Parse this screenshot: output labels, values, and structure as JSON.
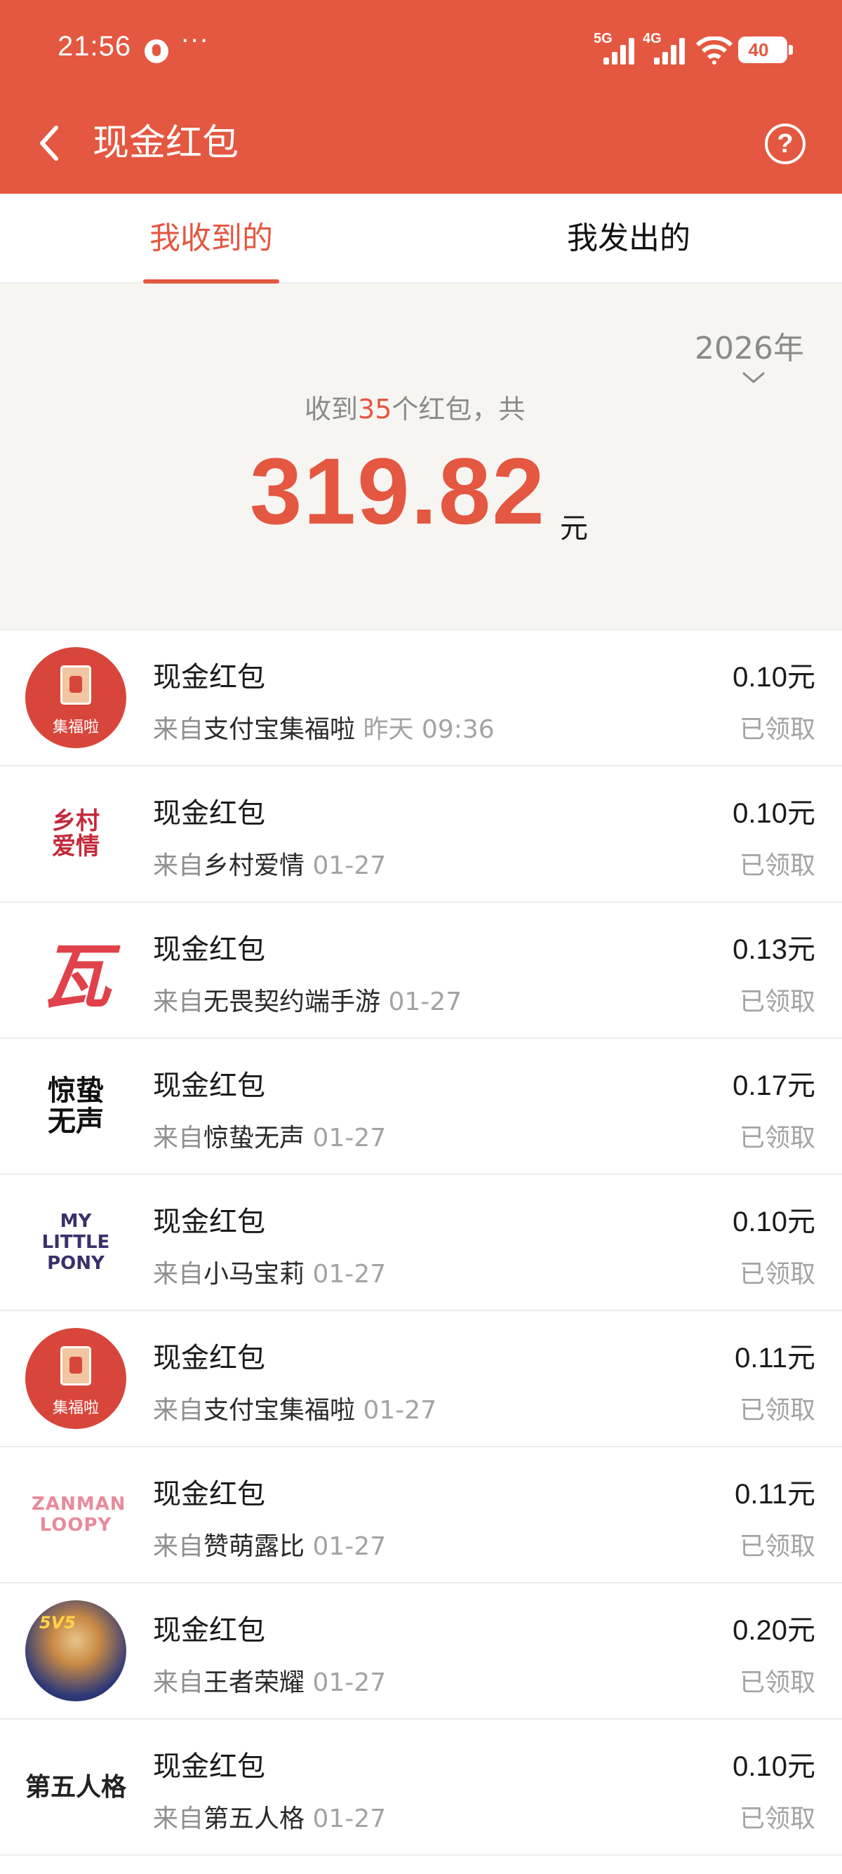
{
  "status_bar": {
    "time": "21:56",
    "more": "···",
    "sim1": "5G",
    "sim2": "4G",
    "battery": "40"
  },
  "header": {
    "title": "现金红包",
    "icons": [
      "back-icon",
      "help-icon"
    ]
  },
  "tabs": [
    {
      "label": "我收到的",
      "active": true
    },
    {
      "label": "我发出的",
      "active": false
    }
  ],
  "summary": {
    "year": "2026年",
    "prefix": "收到",
    "count": "35",
    "suffix": "个红包，共",
    "total": "319.82",
    "unit": "元"
  },
  "list": {
    "items": [
      {
        "title": "现金红包",
        "from_prefix": "来自",
        "source": "支付宝集福啦",
        "date": "昨天 09:36",
        "amount": "0.10",
        "currency": "元",
        "status": "已领取",
        "avatar_text": "集福啦"
      },
      {
        "title": "现金红包",
        "from_prefix": "来自",
        "source": "乡村爱情",
        "date": "01-27",
        "amount": "0.10",
        "currency": "元",
        "status": "已领取",
        "avatar_text": "乡村爱情"
      },
      {
        "title": "现金红包",
        "from_prefix": "来自",
        "source": "无畏契约端手游",
        "date": "01-27",
        "amount": "0.13",
        "currency": "元",
        "status": "已领取",
        "avatar_text": "瓦"
      },
      {
        "title": "现金红包",
        "from_prefix": "来自",
        "source": "惊蛰无声",
        "date": "01-27",
        "amount": "0.17",
        "currency": "元",
        "status": "已领取",
        "avatar_text": "惊蛰无声"
      },
      {
        "title": "现金红包",
        "from_prefix": "来自",
        "source": "小马宝莉",
        "date": "01-27",
        "amount": "0.10",
        "currency": "元",
        "status": "已领取",
        "avatar_text": "MY LITTLE PONY"
      },
      {
        "title": "现金红包",
        "from_prefix": "来自",
        "source": "支付宝集福啦",
        "date": "01-27",
        "amount": "0.11",
        "currency": "元",
        "status": "已领取",
        "avatar_text": "集福啦"
      },
      {
        "title": "现金红包",
        "from_prefix": "来自",
        "source": "赞萌露比",
        "date": "01-27",
        "amount": "0.11",
        "currency": "元",
        "status": "已领取",
        "avatar_text": "ZANMANG LOOPY"
      },
      {
        "title": "现金红包",
        "from_prefix": "来自",
        "source": "王者荣耀",
        "date": "01-27",
        "amount": "0.20",
        "currency": "元",
        "status": "已领取",
        "avatar_text": "5V5"
      },
      {
        "title": "现金红包",
        "from_prefix": "来自",
        "source": "第五人格",
        "date": "01-27",
        "amount": "0.10",
        "currency": "元",
        "status": "已领取",
        "avatar_text": "第五人格"
      }
    ]
  },
  "colors": {
    "brand": "#e45740",
    "summary_bg": "#f7f5f2",
    "muted_text": "#8f8f8f"
  }
}
